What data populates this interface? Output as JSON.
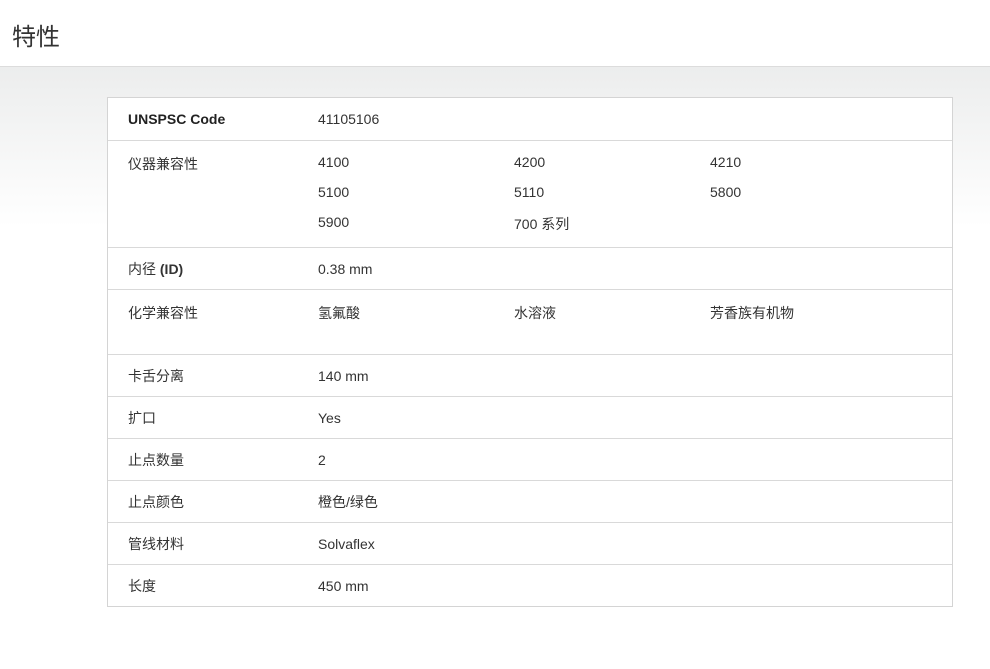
{
  "header": {
    "title": "特性"
  },
  "specs": {
    "unspsc": {
      "label": "UNSPSC Code",
      "value": "41105106"
    },
    "instrument": {
      "label": "仪器兼容性",
      "values": [
        "4100",
        "4200",
        "4210",
        "5100",
        "5110",
        "5800",
        "5900",
        "700 系列"
      ]
    },
    "id": {
      "label_prefix": "内径 ",
      "label_abbr": "(ID)",
      "value": "0.38 mm"
    },
    "chemical": {
      "label": "化学兼容性",
      "values": [
        "氢氟酸",
        "水溶液",
        "芳香族有机物"
      ]
    },
    "tab_separation": {
      "label": "卡舌分离",
      "value": "140 mm"
    },
    "flared": {
      "label": "扩口",
      "value": "Yes"
    },
    "stop_count": {
      "label": "止点数量",
      "value": "2"
    },
    "stop_color": {
      "label": "止点颜色",
      "value": "橙色/绿色"
    },
    "tubing_material": {
      "label": "管线材料",
      "value": "Solvaflex"
    },
    "length": {
      "label": "长度",
      "value": "450 mm"
    }
  }
}
